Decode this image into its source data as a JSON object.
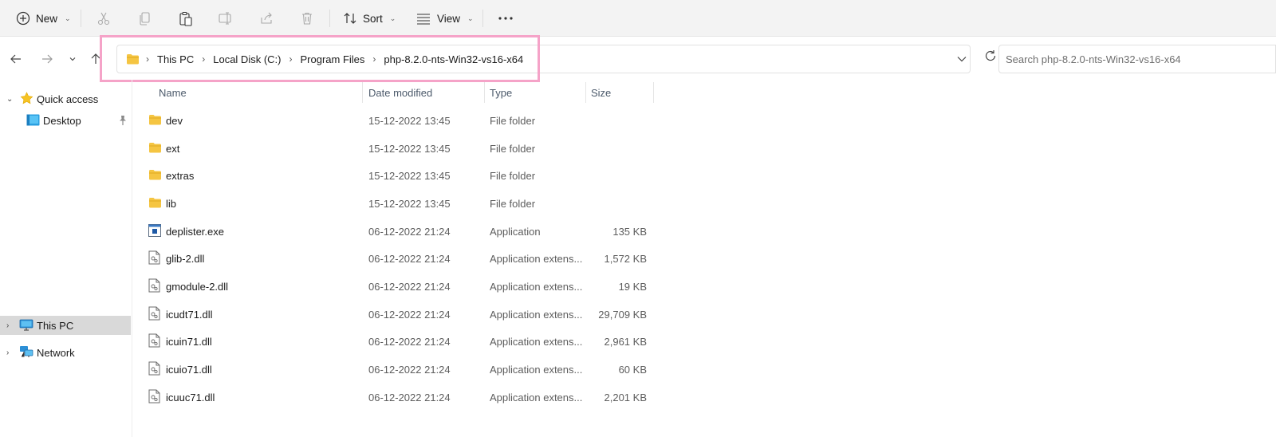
{
  "toolbar": {
    "new_label": "New",
    "sort_label": "Sort",
    "view_label": "View"
  },
  "address": {
    "crumbs": [
      "This PC",
      "Local Disk (C:)",
      "Program Files",
      "php-8.2.0-nts-Win32-vs16-x64"
    ]
  },
  "search": {
    "placeholder": "Search php-8.2.0-nts-Win32-vs16-x64"
  },
  "sidebar": {
    "items": [
      {
        "label": "Quick access",
        "icon": "star-icon"
      },
      {
        "label": "Desktop",
        "icon": "desktop-icon"
      },
      {
        "label": "This PC",
        "icon": "computer-icon"
      },
      {
        "label": "Network",
        "icon": "network-icon"
      }
    ]
  },
  "columns": {
    "name": "Name",
    "date": "Date modified",
    "type": "Type",
    "size": "Size"
  },
  "files": [
    {
      "name": "dev",
      "date": "15-12-2022 13:45",
      "type": "File folder",
      "size": "",
      "icon": "folder-icon"
    },
    {
      "name": "ext",
      "date": "15-12-2022 13:45",
      "type": "File folder",
      "size": "",
      "icon": "folder-icon"
    },
    {
      "name": "extras",
      "date": "15-12-2022 13:45",
      "type": "File folder",
      "size": "",
      "icon": "folder-icon"
    },
    {
      "name": "lib",
      "date": "15-12-2022 13:45",
      "type": "File folder",
      "size": "",
      "icon": "folder-icon"
    },
    {
      "name": "deplister.exe",
      "date": "06-12-2022 21:24",
      "type": "Application",
      "size": "135 KB",
      "icon": "application-icon"
    },
    {
      "name": "glib-2.dll",
      "date": "06-12-2022 21:24",
      "type": "Application extens...",
      "size": "1,572 KB",
      "icon": "dll-file-icon"
    },
    {
      "name": "gmodule-2.dll",
      "date": "06-12-2022 21:24",
      "type": "Application extens...",
      "size": "19 KB",
      "icon": "dll-file-icon"
    },
    {
      "name": "icudt71.dll",
      "date": "06-12-2022 21:24",
      "type": "Application extens...",
      "size": "29,709 KB",
      "icon": "dll-file-icon"
    },
    {
      "name": "icuin71.dll",
      "date": "06-12-2022 21:24",
      "type": "Application extens...",
      "size": "2,961 KB",
      "icon": "dll-file-icon"
    },
    {
      "name": "icuio71.dll",
      "date": "06-12-2022 21:24",
      "type": "Application extens...",
      "size": "60 KB",
      "icon": "dll-file-icon"
    },
    {
      "name": "icuuc71.dll",
      "date": "06-12-2022 21:24",
      "type": "Application extens...",
      "size": "2,201 KB",
      "icon": "dll-file-icon"
    }
  ],
  "colors": {
    "highlight": "#f5a3c8",
    "folder": "#f5c542",
    "selected_bg": "#d9d9d9"
  }
}
